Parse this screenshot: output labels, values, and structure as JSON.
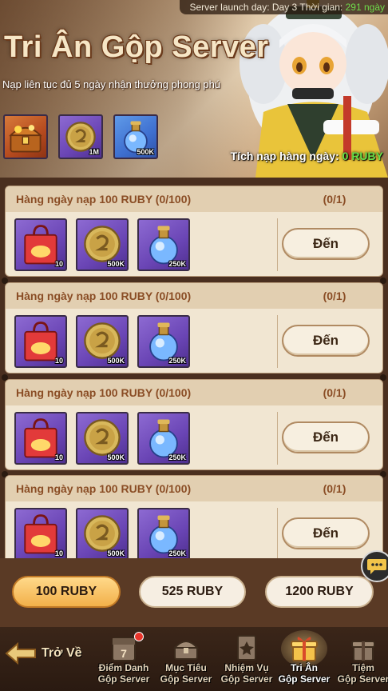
{
  "header": {
    "top_info": "Server launch day: Day 3",
    "time_left_label": "Thời gian:",
    "time_left_value": "291 ngày",
    "title": "Tri Ân Gộp Server",
    "subtitle": "Nạp liên tục đủ 5 ngày nhận thưởng phong phú",
    "daily_label": "Tích nạp hàng ngày:",
    "daily_value": "0 RUBY",
    "top_rewards": [
      {
        "icon": "treasure-chest-icon",
        "qty": ""
      },
      {
        "icon": "gold-coin-icon",
        "qty": "1M"
      },
      {
        "icon": "potion-flask-icon",
        "qty": "500K"
      }
    ]
  },
  "tasks": [
    {
      "label": "Hàng ngày nạp 100 RUBY (0/100)",
      "progress": "(0/1)",
      "button": "Đến",
      "items": [
        {
          "icon": "gift-bag-icon",
          "qty": "10"
        },
        {
          "icon": "gold-coin-icon",
          "qty": "500K"
        },
        {
          "icon": "potion-flask-icon",
          "qty": "250K"
        }
      ]
    },
    {
      "label": "Hàng ngày nạp 100 RUBY (0/100)",
      "progress": "(0/1)",
      "button": "Đến",
      "items": [
        {
          "icon": "gift-bag-icon",
          "qty": "10"
        },
        {
          "icon": "gold-coin-icon",
          "qty": "500K"
        },
        {
          "icon": "potion-flask-icon",
          "qty": "250K"
        }
      ]
    },
    {
      "label": "Hàng ngày nạp 100 RUBY (0/100)",
      "progress": "(0/1)",
      "button": "Đến",
      "items": [
        {
          "icon": "gift-bag-icon",
          "qty": "10"
        },
        {
          "icon": "gold-coin-icon",
          "qty": "500K"
        },
        {
          "icon": "potion-flask-icon",
          "qty": "250K"
        }
      ]
    },
    {
      "label": "Hàng ngày nạp 100 RUBY (0/100)",
      "progress": "(0/1)",
      "button": "Đến",
      "items": [
        {
          "icon": "gift-bag-icon",
          "qty": "10"
        },
        {
          "icon": "gold-coin-icon",
          "qty": "500K"
        },
        {
          "icon": "potion-flask-icon",
          "qty": "250K"
        }
      ]
    }
  ],
  "amount_tabs": [
    {
      "label": "100 RUBY",
      "selected": true
    },
    {
      "label": "525 RUBY",
      "selected": false
    },
    {
      "label": "1200 RUBY",
      "selected": false
    }
  ],
  "nav": {
    "back_label": "Trở Về",
    "items": [
      {
        "line1": "Điểm Danh",
        "line2": "Gộp Server",
        "icon": "calendar-icon",
        "badge": true
      },
      {
        "line1": "Mục Tiêu",
        "line2": "Gộp Server",
        "icon": "chest-icon",
        "badge": false
      },
      {
        "line1": "Nhiệm Vụ",
        "line2": "Gộp Server",
        "icon": "quest-card-icon",
        "badge": false
      },
      {
        "line1": "Tri Ân",
        "line2": "Gộp Server",
        "icon": "gift-box-icon",
        "badge": false,
        "active": true
      },
      {
        "line1": "Tiệm",
        "line2": "Gộp Server",
        "icon": "shop-gift-icon",
        "badge": false
      }
    ]
  },
  "colors": {
    "accent_green": "#6fdc4b",
    "selected_tab": "#f2b04a",
    "card_bg": "#f1e6d2",
    "card_header_text": "#8a4d25"
  }
}
